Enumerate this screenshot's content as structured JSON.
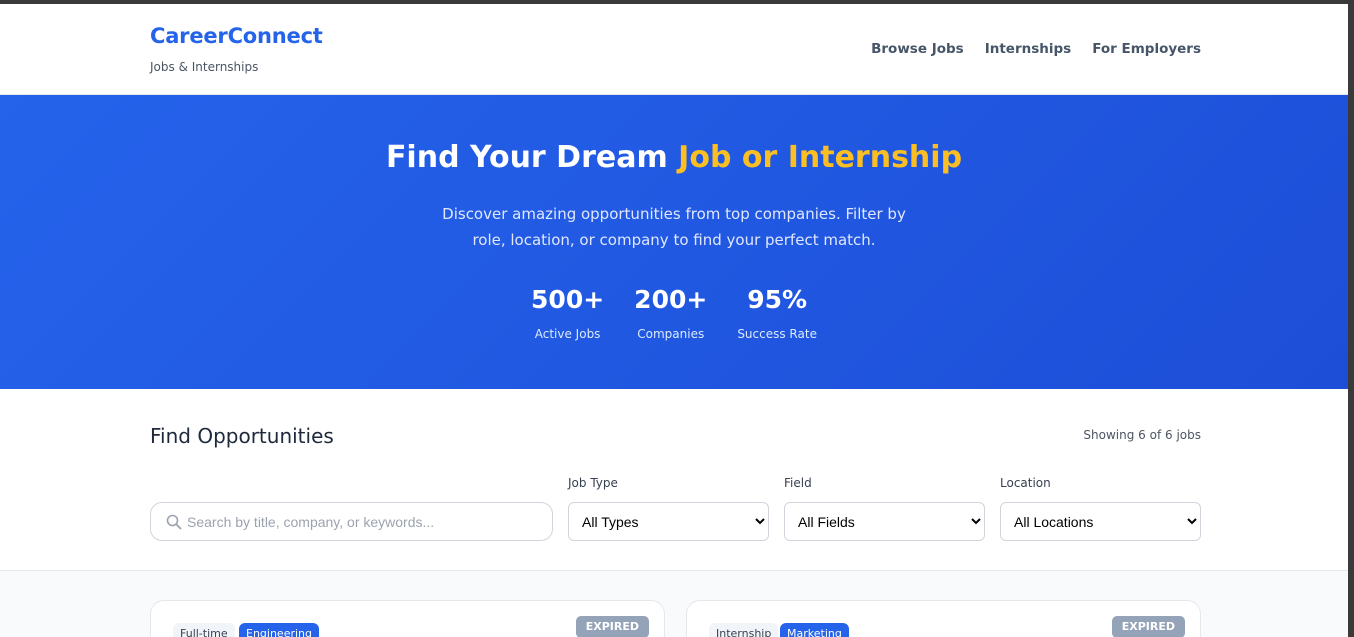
{
  "header": {
    "brand_name": "CareerConnect",
    "brand_tagline": "Jobs & Internships",
    "nav": [
      "Browse Jobs",
      "Internships",
      "For Employers"
    ]
  },
  "hero": {
    "title_main": "Find Your Dream ",
    "title_accent": "Job or Internship",
    "description": "Discover amazing opportunities from top companies. Filter by role, location, or company to find your perfect match.",
    "stats": [
      {
        "value": "500+",
        "label": "Active Jobs"
      },
      {
        "value": "200+",
        "label": "Companies"
      },
      {
        "value": "95%",
        "label": "Success Rate"
      }
    ]
  },
  "filters": {
    "heading": "Find Opportunities",
    "showing": "Showing 6 of 6 jobs",
    "search_placeholder": "Search by title, company, or keywords...",
    "job_type": {
      "label": "Job Type",
      "selected": "All Types"
    },
    "field": {
      "label": "Field",
      "selected": "All Fields"
    },
    "location": {
      "label": "Location",
      "selected": "All Locations"
    }
  },
  "cards": [
    {
      "type": "Full-time",
      "field": "Engineering",
      "status": "EXPIRED"
    },
    {
      "type": "Internship",
      "field": "Marketing",
      "status": "EXPIRED"
    }
  ],
  "colors": {
    "primary": "#2563eb",
    "accent": "#fbbf24",
    "expired": "#94a3b8"
  }
}
